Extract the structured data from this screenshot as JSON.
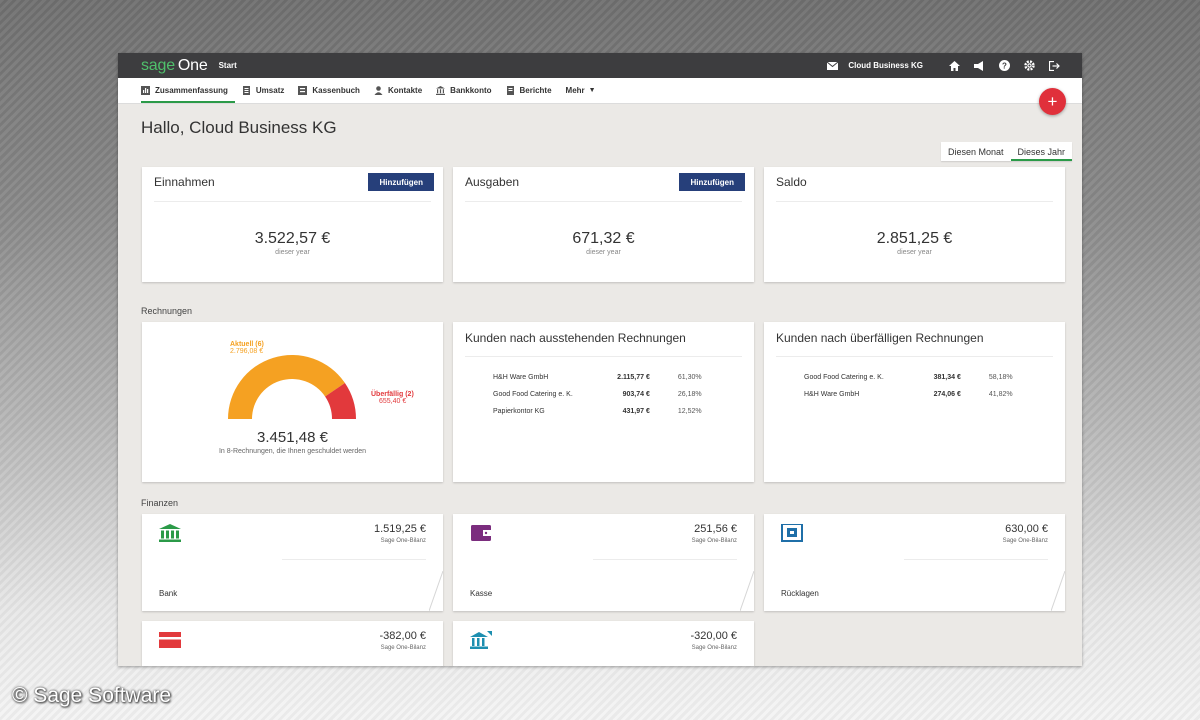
{
  "topbar": {
    "logo_sage": "sage",
    "logo_one": "One",
    "start": "Start",
    "company": "Cloud Business KG",
    "icons": [
      "mail-icon",
      "home-icon",
      "megaphone-icon",
      "help-icon",
      "gear-icon",
      "logout-icon"
    ]
  },
  "nav": {
    "items": [
      {
        "label": "Zusammenfassung",
        "icon": "summary-icon"
      },
      {
        "label": "Umsatz",
        "icon": "document-icon"
      },
      {
        "label": "Kassenbuch",
        "icon": "cashbook-icon"
      },
      {
        "label": "Kontakte",
        "icon": "person-icon"
      },
      {
        "label": "Bankkonto",
        "icon": "bank-icon"
      },
      {
        "label": "Berichte",
        "icon": "report-icon"
      }
    ],
    "more": "Mehr"
  },
  "fab": "+",
  "greeting": "Hallo, Cloud Business KG",
  "period": {
    "month": "Diesen Monat",
    "year": "Dieses Jahr",
    "selected": "year"
  },
  "kpis": [
    {
      "title": "Einnahmen",
      "button": "Hinzufügen",
      "amount": "3.522,57 €",
      "sub": "dieser year"
    },
    {
      "title": "Ausgaben",
      "button": "Hinzufügen",
      "amount": "671,32 €",
      "sub": "dieser year"
    },
    {
      "title": "Saldo",
      "amount": "2.851,25 €",
      "sub": "dieser year"
    }
  ],
  "rechnungen": {
    "section": "Rechnungen",
    "gauge": {
      "current_label": "Aktuell (6)",
      "current_amount": "2.796,08 €",
      "overdue_label": "Überfällig (2)",
      "overdue_amount": "655,40 €",
      "total": "3.451,48 €",
      "sub": "In 8-Rechnungen, die Ihnen geschuldet werden",
      "current_fraction": 0.81,
      "colors": {
        "current": "#f5a122",
        "overdue": "#e2393c"
      }
    },
    "outstanding": {
      "title": "Kunden nach ausstehenden Rechnungen",
      "rows": [
        {
          "name": "H&H Ware GmbH",
          "amount": "2.115,77 €",
          "pct": "61,30%"
        },
        {
          "name": "Good Food Catering e. K.",
          "amount": "903,74 €",
          "pct": "26,18%"
        },
        {
          "name": "Papierkontor KG",
          "amount": "431,97 €",
          "pct": "12,52%"
        }
      ]
    },
    "overdue": {
      "title": "Kunden nach überfälligen Rechnungen",
      "rows": [
        {
          "name": "Good Food Catering e. K.",
          "amount": "381,34 €",
          "pct": "58,18%"
        },
        {
          "name": "H&H Ware GmbH",
          "amount": "274,06 €",
          "pct": "41,82%"
        }
      ]
    }
  },
  "finanzen": {
    "section": "Finanzen",
    "accounts": [
      {
        "name": "Bank",
        "amount": "1.519,25 €",
        "sub": "Sage One-Bilanz",
        "icon": "bank-icon",
        "color": "#2b9a48"
      },
      {
        "name": "Kasse",
        "amount": "251,56 €",
        "sub": "Sage One-Bilanz",
        "icon": "wallet-icon",
        "color": "#7b2d7e"
      },
      {
        "name": "Rücklagen",
        "amount": "630,00 €",
        "sub": "Sage One-Bilanz",
        "icon": "safe-icon",
        "color": "#1f6fa8"
      },
      {
        "name": "",
        "amount": "-382,00 €",
        "sub": "Sage One-Bilanz",
        "icon": "credit-card-icon",
        "color": "#e2393c"
      },
      {
        "name": "",
        "amount": "-320,00 €",
        "sub": "Sage One-Bilanz",
        "icon": "loan-icon",
        "color": "#1d8fb0"
      }
    ]
  },
  "watermark": "© Sage Software"
}
